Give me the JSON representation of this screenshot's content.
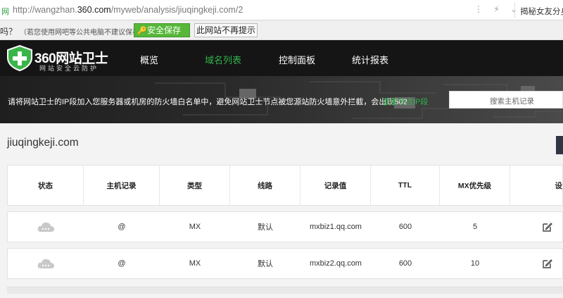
{
  "browser": {
    "site_label": "网",
    "url_prefix": "http://wangzhan.",
    "url_host": "360.com",
    "url_path": "/myweb/analysis/jiuqingkeji.com/2",
    "toolbar_icons": "⋮ ⚡ ⌄",
    "news_text": "揭秘女友分身"
  },
  "password_bar": {
    "question": "吗？",
    "hint": "（若您使用网吧等公共电脑不建议保存）",
    "save_label": "安全保存",
    "never_label": "此网站不再提示"
  },
  "nav": {
    "brand": "360网站卫士",
    "brand_sub": "网站安全云防护",
    "items": [
      {
        "label": "概览",
        "active": false
      },
      {
        "label": "域名列表",
        "active": true
      },
      {
        "label": "控制面板",
        "active": false
      },
      {
        "label": "统计报表",
        "active": false
      }
    ]
  },
  "banner": {
    "notice": "请将网站卫士的IP段加入您服务器或机房的防火墙白名单中，避免网站卫士节点被您源站防火墙意外拦截，会出现502",
    "link": "查看节点IP段",
    "search_placeholder": "搜索主机记录"
  },
  "content": {
    "domain": "jiuqingkeji.com"
  },
  "table": {
    "headers": [
      "状态",
      "主机记录",
      "类型",
      "线路",
      "记录值",
      "TTL",
      "MX优先级",
      "设"
    ],
    "rows": [
      {
        "host": "@",
        "type": "MX",
        "line": "默认",
        "value": "mxbiz1.qq.com",
        "ttl": "600",
        "mx": "5"
      },
      {
        "host": "@",
        "type": "MX",
        "line": "默认",
        "value": "mxbiz2.qq.com",
        "ttl": "600",
        "mx": "10"
      }
    ]
  },
  "colors": {
    "accent_green": "#31b34b",
    "nav_bg": "#151515",
    "save_button": "#57b73a"
  }
}
